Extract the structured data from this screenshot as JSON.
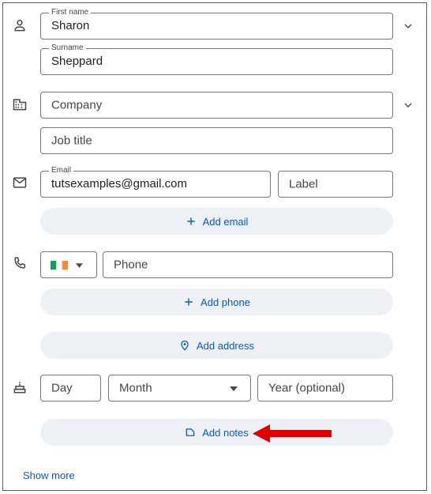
{
  "name": {
    "first_label": "First name",
    "first_value": "Sharon",
    "surname_label": "Surname",
    "surname_value": "Sheppard"
  },
  "org": {
    "company_placeholder": "Company",
    "job_placeholder": "Job title"
  },
  "email": {
    "label": "Email",
    "value": "tutsexamples@gmail.com",
    "label_placeholder": "Label",
    "add_label": "Add email"
  },
  "phone": {
    "country": "Ireland",
    "placeholder": "Phone",
    "add_label": "Add phone"
  },
  "address": {
    "add_label": "Add address"
  },
  "birthday": {
    "day_placeholder": "Day",
    "month_placeholder": "Month",
    "year_placeholder": "Year (optional)"
  },
  "notes": {
    "add_label": "Add notes"
  },
  "footer": {
    "show_more": "Show more"
  },
  "icons": {
    "person": "person-icon",
    "company": "company-icon",
    "email": "email-icon",
    "phone": "phone-icon",
    "birthday": "cake-icon",
    "address": "location-pin-icon",
    "notes": "note-icon",
    "chevron": "chevron-down-icon"
  },
  "colors": {
    "accent": "#0b57d0",
    "pill_bg": "#edf0f5",
    "icon": "#444746",
    "arrow": "#e00000",
    "flag_green": "#169b62",
    "flag_orange": "#ff883e"
  }
}
